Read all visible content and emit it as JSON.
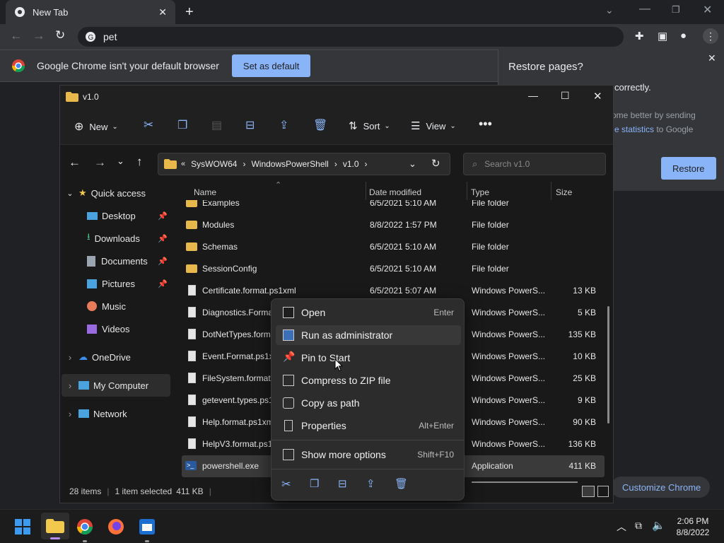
{
  "chrome": {
    "tab_title": "New Tab",
    "omnibox_text": "pet",
    "infobar_text": "Google Chrome isn't your default browser",
    "set_default_label": "Set as default",
    "restore_title": "Restore pages?",
    "restore_line1": "correctly.",
    "restore_line2": "ome better by sending",
    "restore_link": "e statistics",
    "restore_line3": " to Google",
    "restore_button": "Restore",
    "customize_label": "Customize Chrome"
  },
  "explorer": {
    "window_title": "v1.0",
    "cmd": {
      "new": "New",
      "sort": "Sort",
      "view": "View"
    },
    "breadcrumb": [
      "SysWOW64",
      "WindowsPowerShell",
      "v1.0"
    ],
    "search_placeholder": "Search v1.0",
    "nav": [
      {
        "label": "Quick access"
      },
      {
        "label": "Desktop"
      },
      {
        "label": "Downloads"
      },
      {
        "label": "Documents"
      },
      {
        "label": "Pictures"
      },
      {
        "label": "Music"
      },
      {
        "label": "Videos"
      },
      {
        "label": "OneDrive"
      },
      {
        "label": "My Computer"
      },
      {
        "label": "Network"
      }
    ],
    "columns": {
      "name": "Name",
      "date": "Date modified",
      "type": "Type",
      "size": "Size"
    },
    "rows": [
      {
        "name": "Examples",
        "date": "6/5/2021 5:10 AM",
        "type": "File folder",
        "size": ""
      },
      {
        "name": "Modules",
        "date": "8/8/2022 1:57 PM",
        "type": "File folder",
        "size": ""
      },
      {
        "name": "Schemas",
        "date": "6/5/2021 5:10 AM",
        "type": "File folder",
        "size": ""
      },
      {
        "name": "SessionConfig",
        "date": "6/5/2021 5:10 AM",
        "type": "File folder",
        "size": ""
      },
      {
        "name": "Certificate.format.ps1xml",
        "date": "6/5/2021 5:07 AM",
        "type": "Windows PowerS...",
        "size": "13 KB"
      },
      {
        "name": "Diagnostics.Format",
        "date": "",
        "type": "Windows PowerS...",
        "size": "5 KB"
      },
      {
        "name": "DotNetTypes.forma",
        "date": "",
        "type": "Windows PowerS...",
        "size": "135 KB"
      },
      {
        "name": "Event.Format.ps1x",
        "date": "",
        "type": "Windows PowerS...",
        "size": "10 KB"
      },
      {
        "name": "FileSystem.format.",
        "date": "",
        "type": "Windows PowerS...",
        "size": "25 KB"
      },
      {
        "name": "getevent.types.ps1",
        "date": "",
        "type": "Windows PowerS...",
        "size": "9 KB"
      },
      {
        "name": "Help.format.ps1xm",
        "date": "",
        "type": "Windows PowerS...",
        "size": "90 KB"
      },
      {
        "name": "HelpV3.format.ps1",
        "date": "",
        "type": "Windows PowerS...",
        "size": "136 KB"
      },
      {
        "name": "powershell.exe",
        "date": "",
        "type": "Application",
        "size": "411 KB"
      }
    ],
    "status": {
      "count": "28 items",
      "selected": "1 item selected",
      "size": "411 KB"
    }
  },
  "context_menu": {
    "items": [
      {
        "label": "Open",
        "shortcut": "Enter"
      },
      {
        "label": "Run as administrator",
        "shortcut": ""
      },
      {
        "label": "Pin to Start",
        "shortcut": ""
      },
      {
        "label": "Compress to ZIP file",
        "shortcut": ""
      },
      {
        "label": "Copy as path",
        "shortcut": ""
      },
      {
        "label": "Properties",
        "shortcut": "Alt+Enter"
      },
      {
        "label": "Show more options",
        "shortcut": "Shift+F10"
      }
    ]
  },
  "taskbar": {
    "time": "2:06 PM",
    "date": "8/8/2022"
  },
  "colors": {
    "accent": "#8ab4f8",
    "folder": "#e8b84a",
    "selected_row": "#3a3a3a"
  }
}
